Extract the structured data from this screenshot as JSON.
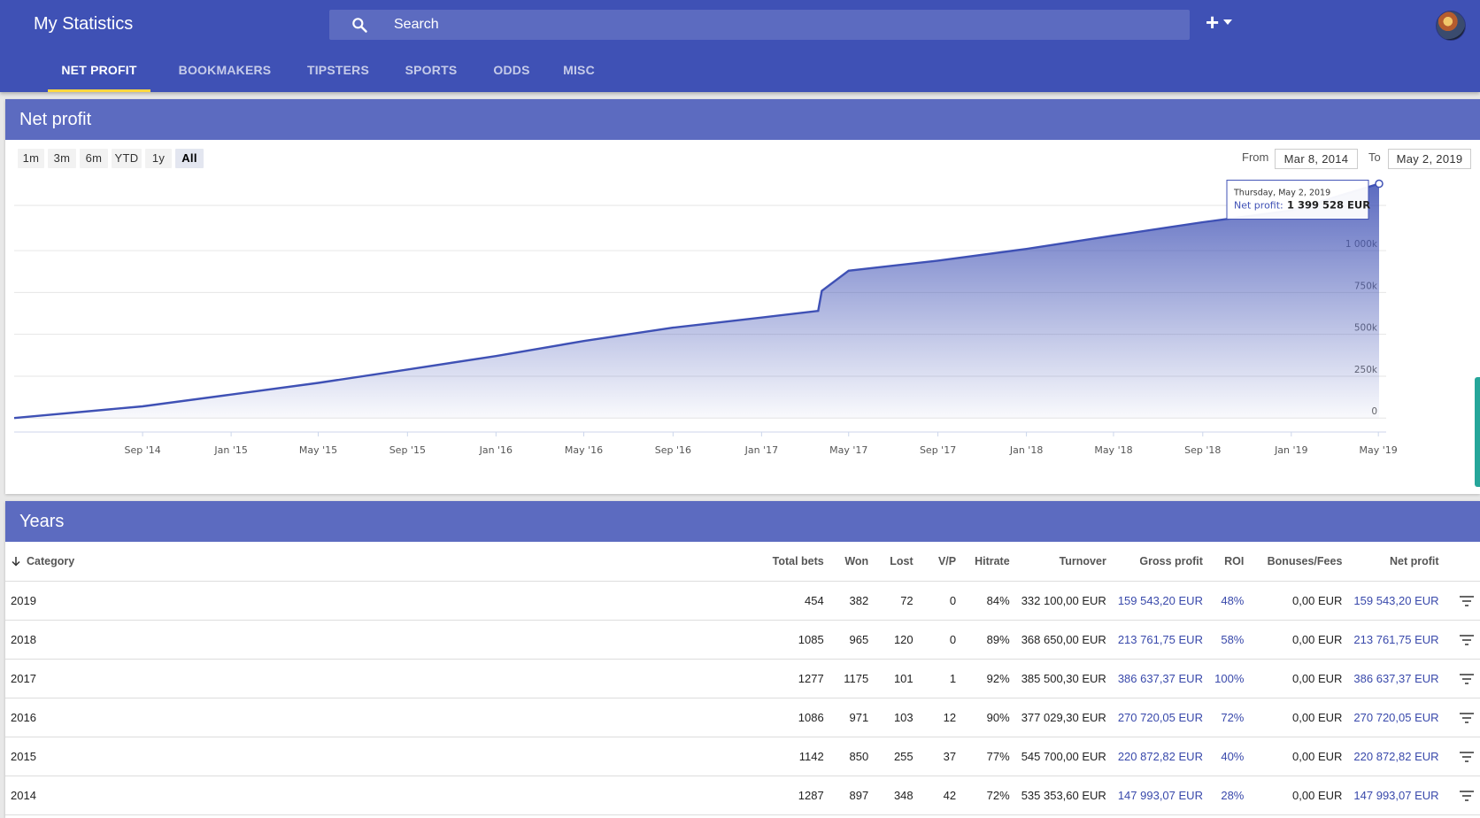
{
  "app": {
    "title": "My Statistics"
  },
  "search": {
    "placeholder": "Search"
  },
  "tabs": [
    "NET PROFIT",
    "BOOKMAKERS",
    "TIPSTERS",
    "SPORTS",
    "ODDS",
    "MISC"
  ],
  "active_tab": "NET PROFIT",
  "chart_panel": {
    "title": "Net profit",
    "ranges": [
      "1m",
      "3m",
      "6m",
      "YTD",
      "1y",
      "All"
    ],
    "active_range": "All",
    "from_label": "From",
    "from_value": "Mar 8, 2014",
    "to_label": "To",
    "to_value": "May 2, 2019"
  },
  "tooltip": {
    "date": "Thursday, May 2, 2019",
    "label": "Net profit:",
    "value": "1 399 528 EUR"
  },
  "chart_data": {
    "type": "area",
    "title": "",
    "xlabel": "",
    "ylabel": "",
    "ylim": [
      -20000,
      1450000
    ],
    "ytick_values": [
      0,
      250000,
      500000,
      750000,
      1000000
    ],
    "yticks": [
      "0",
      "250k",
      "500k",
      "750k",
      "1 000k"
    ],
    "xticks": [
      "Sep '14",
      "Jan '15",
      "May '15",
      "Sep '15",
      "Jan '16",
      "May '16",
      "Sep '16",
      "Jan '17",
      "May '17",
      "Sep '17",
      "Jan '18",
      "May '18",
      "Sep '18",
      "Jan '19",
      "May '19"
    ],
    "xtick_dates": [
      "2014-09-01",
      "2015-01-01",
      "2015-05-01",
      "2015-09-01",
      "2016-01-01",
      "2016-05-01",
      "2016-09-01",
      "2017-01-01",
      "2017-05-01",
      "2017-09-01",
      "2018-01-01",
      "2018-05-01",
      "2018-09-01",
      "2019-01-01",
      "2019-05-01"
    ],
    "grid": true,
    "series": [
      {
        "color": "#3f51b5",
        "points": [
          [
            "2014-03-08",
            0
          ],
          [
            "2014-09-01",
            70000
          ],
          [
            "2015-01-01",
            140000
          ],
          [
            "2015-05-01",
            210000
          ],
          [
            "2015-09-01",
            290000
          ],
          [
            "2016-01-01",
            370000
          ],
          [
            "2016-05-01",
            460000
          ],
          [
            "2016-09-01",
            540000
          ],
          [
            "2017-01-01",
            600000
          ],
          [
            "2017-03-20",
            640000
          ],
          [
            "2017-03-25",
            760000
          ],
          [
            "2017-05-01",
            880000
          ],
          [
            "2017-09-01",
            940000
          ],
          [
            "2018-01-01",
            1010000
          ],
          [
            "2018-05-01",
            1090000
          ],
          [
            "2018-09-01",
            1170000
          ],
          [
            "2019-01-01",
            1240000
          ],
          [
            "2019-05-02",
            1399528
          ]
        ]
      }
    ]
  },
  "years_panel": {
    "title": "Years",
    "columns": [
      "Category",
      "Total bets",
      "Won",
      "Lost",
      "V/P",
      "Hitrate",
      "Turnover",
      "Gross profit",
      "ROI",
      "Bonuses/Fees",
      "Net profit"
    ],
    "rows": [
      [
        "2019",
        "454",
        "382",
        "72",
        "0",
        "84%",
        "332 100,00 EUR",
        "159 543,20 EUR",
        "48%",
        "0,00 EUR",
        "159 543,20 EUR"
      ],
      [
        "2018",
        "1085",
        "965",
        "120",
        "0",
        "89%",
        "368 650,00 EUR",
        "213 761,75 EUR",
        "58%",
        "0,00 EUR",
        "213 761,75 EUR"
      ],
      [
        "2017",
        "1277",
        "1175",
        "101",
        "1",
        "92%",
        "385 500,30 EUR",
        "386 637,37 EUR",
        "100%",
        "0,00 EUR",
        "386 637,37 EUR"
      ],
      [
        "2016",
        "1086",
        "971",
        "103",
        "12",
        "90%",
        "377 029,30 EUR",
        "270 720,05 EUR",
        "72%",
        "0,00 EUR",
        "270 720,05 EUR"
      ],
      [
        "2015",
        "1142",
        "850",
        "255",
        "37",
        "77%",
        "545 700,00 EUR",
        "220 872,82 EUR",
        "40%",
        "0,00 EUR",
        "220 872,82 EUR"
      ],
      [
        "2014",
        "1287",
        "897",
        "348",
        "42",
        "72%",
        "535 353,60 EUR",
        "147 993,07 EUR",
        "28%",
        "0,00 EUR",
        "147 993,07 EUR"
      ]
    ]
  }
}
